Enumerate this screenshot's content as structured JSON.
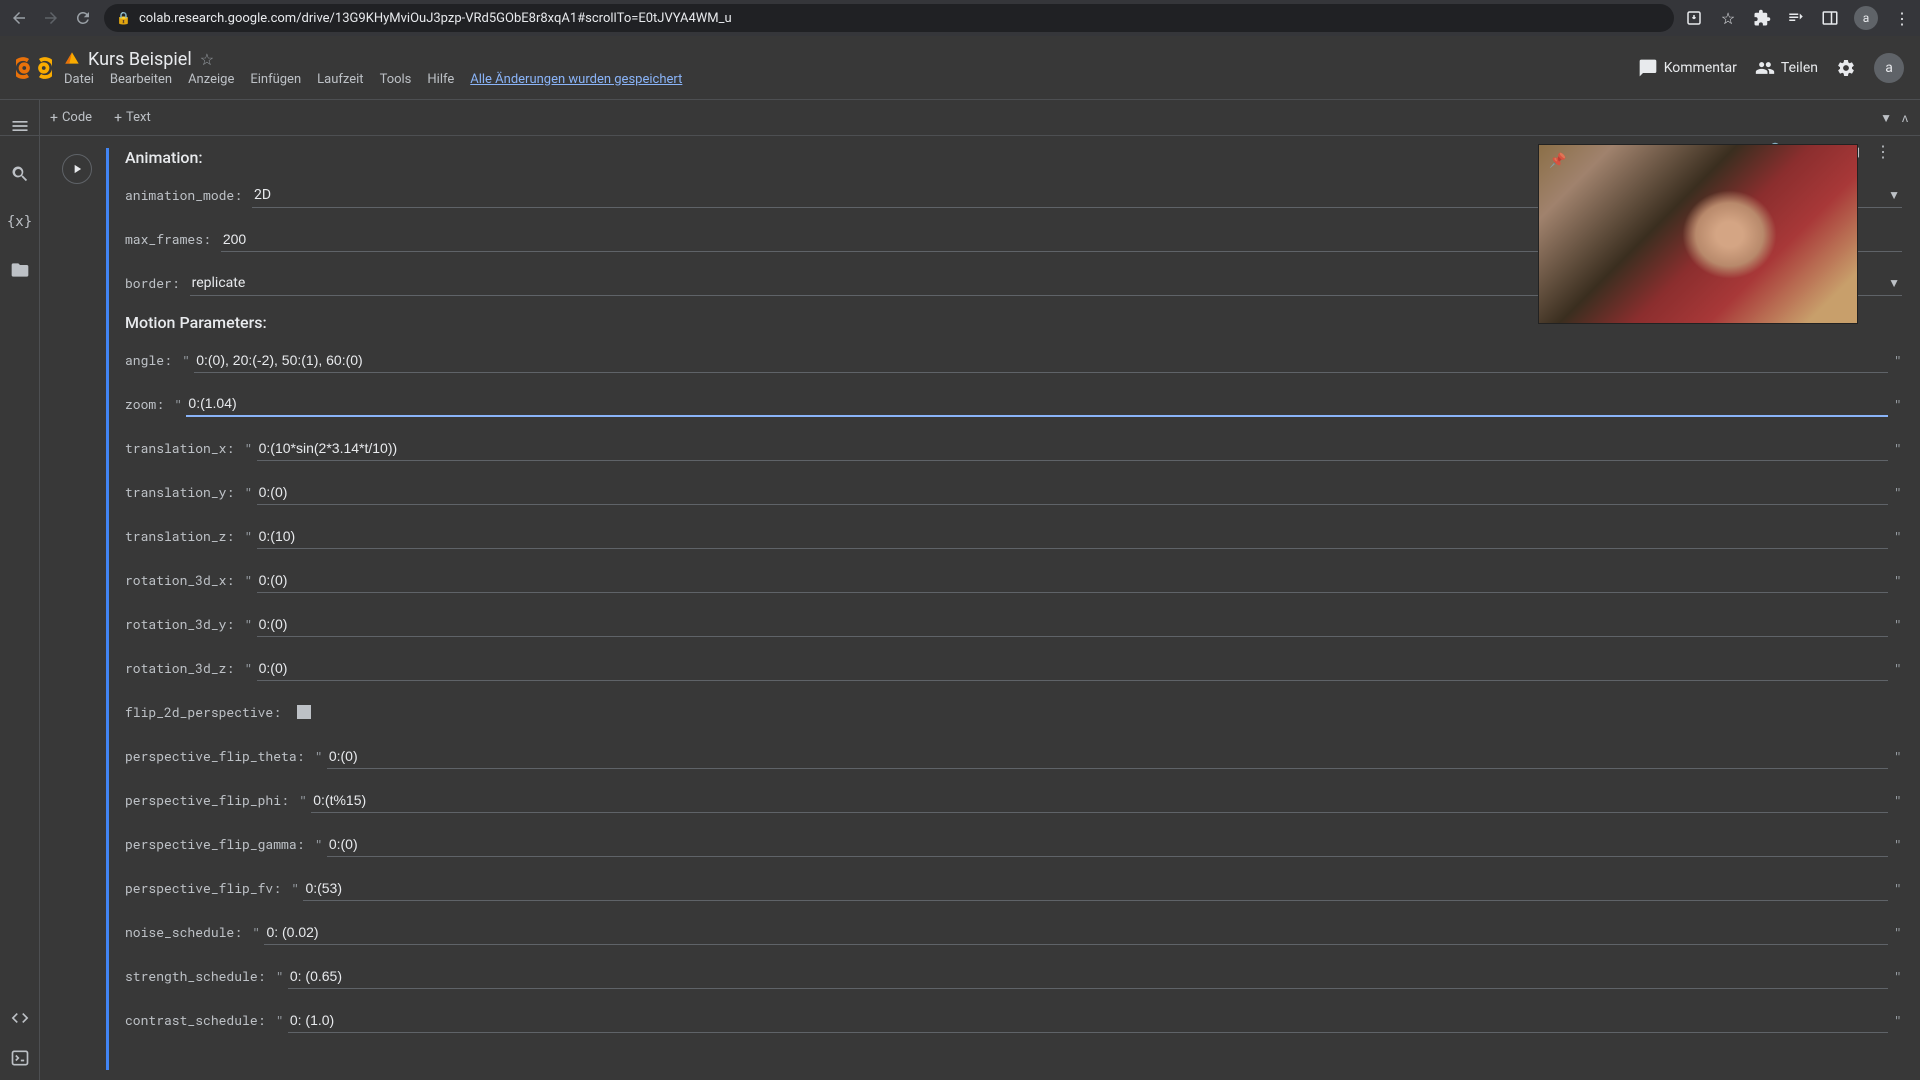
{
  "browser": {
    "url": "colab.research.google.com/drive/13G9KHyMviOuJ3pzp-VRd5GObE8r8xqA1#scrollTo=E0tJVYA4WM_u",
    "avatar": "a"
  },
  "header": {
    "title": "Kurs Beispiel",
    "menus": [
      "Datei",
      "Bearbeiten",
      "Anzeige",
      "Einfügen",
      "Laufzeit",
      "Tools",
      "Hilfe"
    ],
    "save_status": "Alle Änderungen wurden gespeichert",
    "comment_label": "Kommentar",
    "share_label": "Teilen",
    "avatar": "a"
  },
  "toolbar": {
    "code_label": "Code",
    "text_label": "Text"
  },
  "form": {
    "section1_title": "Animation:",
    "section2_title": "Motion Parameters:",
    "animation_mode": {
      "label": "animation_mode:",
      "value": "2D"
    },
    "max_frames": {
      "label": "max_frames:",
      "value": "200"
    },
    "border": {
      "label": "border:",
      "value": "replicate"
    },
    "angle": {
      "label": "angle:",
      "value": "0:(0), 20:(-2), 50:(1), 60:(0)"
    },
    "zoom": {
      "label": "zoom:",
      "value": "0:(1.04)"
    },
    "translation_x": {
      "label": "translation_x:",
      "value": "0:(10*sin(2*3.14*t/10))"
    },
    "translation_y": {
      "label": "translation_y:",
      "value": "0:(0)"
    },
    "translation_z": {
      "label": "translation_z:",
      "value": "0:(10)"
    },
    "rotation_3d_x": {
      "label": "rotation_3d_x:",
      "value": "0:(0)"
    },
    "rotation_3d_y": {
      "label": "rotation_3d_y:",
      "value": "0:(0)"
    },
    "rotation_3d_z": {
      "label": "rotation_3d_z:",
      "value": "0:(0)"
    },
    "flip_2d_perspective": {
      "label": "flip_2d_perspective:"
    },
    "perspective_flip_theta": {
      "label": "perspective_flip_theta:",
      "value": "0:(0)"
    },
    "perspective_flip_phi": {
      "label": "perspective_flip_phi:",
      "value": "0:(t%15)"
    },
    "perspective_flip_gamma": {
      "label": "perspective_flip_gamma:",
      "value": "0:(0)"
    },
    "perspective_flip_fv": {
      "label": "perspective_flip_fv:",
      "value": "0:(53)"
    },
    "noise_schedule": {
      "label": "noise_schedule:",
      "value": "0: (0.02)"
    },
    "strength_schedule": {
      "label": "strength_schedule:",
      "value": "0: (0.65)"
    },
    "contrast_schedule": {
      "label": "contrast_schedule:",
      "value": "0: (1.0)"
    }
  }
}
